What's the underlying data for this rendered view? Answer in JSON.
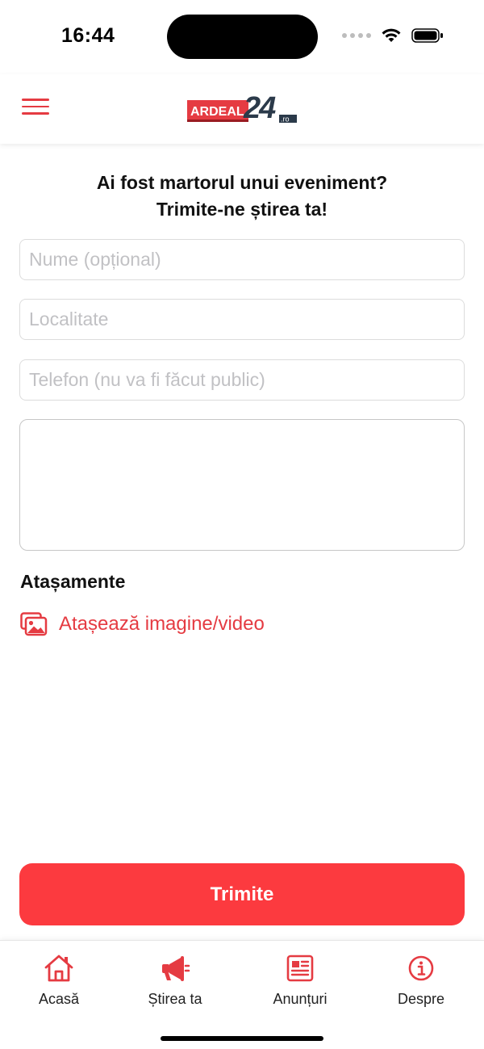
{
  "status_bar": {
    "time": "16:44"
  },
  "header": {
    "menu_icon": "hamburger-menu-icon",
    "logo": {
      "brand_text": "ARDEAL",
      "number_text": "24",
      "tld_text": ".ro"
    }
  },
  "form": {
    "title_line1": "Ai fost martorul unui eveniment?",
    "title_line2": "Trimite-ne știrea ta!",
    "name_placeholder": "Nume (opțional)",
    "locality_placeholder": "Localitate",
    "phone_placeholder": "Telefon (nu va fi făcut public)",
    "message_value": "",
    "attachments_heading": "Atașamente",
    "attach_label": "Atașează imagine/video",
    "attach_icon": "photo-gallery-icon",
    "submit_label": "Trimite"
  },
  "tab_bar": {
    "items": [
      {
        "label": "Acasă",
        "icon": "home-icon"
      },
      {
        "label": "Știrea ta",
        "icon": "megaphone-icon"
      },
      {
        "label": "Anunțuri",
        "icon": "newspaper-icon"
      },
      {
        "label": "Despre",
        "icon": "info-icon"
      }
    ]
  },
  "colors": {
    "accent": "#e53b42",
    "submit_background": "#fc3a3f",
    "logo_dark": "#2b3a4a"
  }
}
